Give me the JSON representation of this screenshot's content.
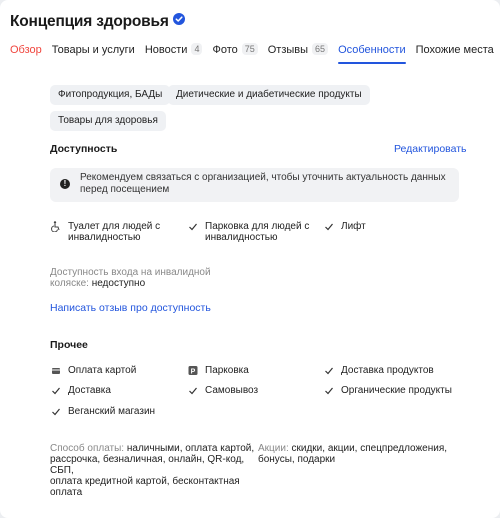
{
  "org": {
    "title": "Концепция здоровья"
  },
  "tabs": [
    {
      "label": "Обзор",
      "count": ""
    },
    {
      "label": "Товары и услуги",
      "count": ""
    },
    {
      "label": "Новости",
      "count": "4"
    },
    {
      "label": "Фото",
      "count": "75"
    },
    {
      "label": "Отзывы",
      "count": "65"
    },
    {
      "label": "Особенности",
      "count": ""
    },
    {
      "label": "Похожие места",
      "count": ""
    }
  ],
  "tags": [
    "Фитопродукция, БАДы",
    "Диетические и диабетические продукты",
    "Товары для здоровья"
  ],
  "accessibility": {
    "title": "Доступность",
    "edit_label": "Редактировать",
    "notice": "Рекомендуем связаться с организацией, чтобы уточнить актуальность данных перед посещением",
    "features": [
      {
        "icon": "wheelchair-icon",
        "line1": "Туалет для людей с",
        "line2": "инвалидностью"
      },
      {
        "icon": "checkmark-icon",
        "line1": "Парковка для людей с",
        "line2": "инвалидностью"
      },
      {
        "icon": "checkmark-icon",
        "line1": "Лифт",
        "line2": ""
      }
    ],
    "entrance_label_1": "Доступность входа на инвалидной",
    "entrance_label_2": "коляске:",
    "entrance_value": "недоступно",
    "review_link": "Написать отзыв про доступность"
  },
  "other": {
    "title": "Прочее",
    "features": [
      {
        "icon": "card-icon",
        "label": "Оплата картой"
      },
      {
        "icon": "parking-icon",
        "label": "Парковка"
      },
      {
        "icon": "checkmark-icon",
        "label": "Доставка продуктов"
      },
      {
        "icon": "checkmark-icon",
        "label": "Доставка"
      },
      {
        "icon": "checkmark-icon",
        "label": "Самовывоз"
      },
      {
        "icon": "checkmark-icon",
        "label": "Органические продукты"
      },
      {
        "icon": "checkmark-icon",
        "label": "Веганский магазин"
      }
    ]
  },
  "payment": {
    "label": "Способ оплаты:",
    "value_1": "наличными, оплата картой,",
    "line_2": "рассрочка, безналичная, онлайн, QR-код, СБП,",
    "line_3": "оплата кредитной картой, бесконтактная",
    "line_4": "оплата"
  },
  "promo": {
    "label": "Акции:",
    "value_1": "скидки, акции, спецпредложения,",
    "line_2": "бонусы, подарки"
  },
  "colors": {
    "accent": "#2255dd",
    "active_first_tab": "#f0463e",
    "chip_bg": "#eff1f4"
  }
}
